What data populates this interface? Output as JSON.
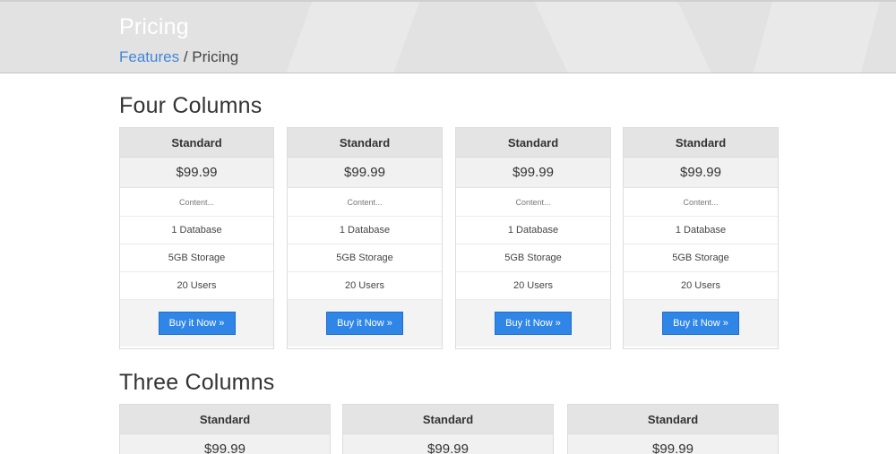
{
  "header": {
    "title": "Pricing",
    "breadcrumb": {
      "link": "Features",
      "separator": "/",
      "current": "Pricing"
    }
  },
  "sections": [
    {
      "title": "Four Columns",
      "plans": [
        {
          "name": "Standard",
          "price": "$99.99",
          "features": [
            "Content...",
            "1 Database",
            "5GB Storage",
            "20 Users"
          ],
          "button": "Buy it Now »"
        },
        {
          "name": "Standard",
          "price": "$99.99",
          "features": [
            "Content...",
            "1 Database",
            "5GB Storage",
            "20 Users"
          ],
          "button": "Buy it Now »"
        },
        {
          "name": "Standard",
          "price": "$99.99",
          "features": [
            "Content...",
            "1 Database",
            "5GB Storage",
            "20 Users"
          ],
          "button": "Buy it Now »"
        },
        {
          "name": "Standard",
          "price": "$99.99",
          "features": [
            "Content...",
            "1 Database",
            "5GB Storage",
            "20 Users"
          ],
          "button": "Buy it Now »"
        }
      ]
    },
    {
      "title": "Three Columns",
      "plans": [
        {
          "name": "Standard",
          "price": "$99.99"
        },
        {
          "name": "Standard",
          "price": "$99.99"
        },
        {
          "name": "Standard",
          "price": "$99.99"
        }
      ]
    }
  ],
  "colors": {
    "accent": "#2f86e6",
    "link": "#3f86d8",
    "header_bg": "#e2e2e2"
  }
}
